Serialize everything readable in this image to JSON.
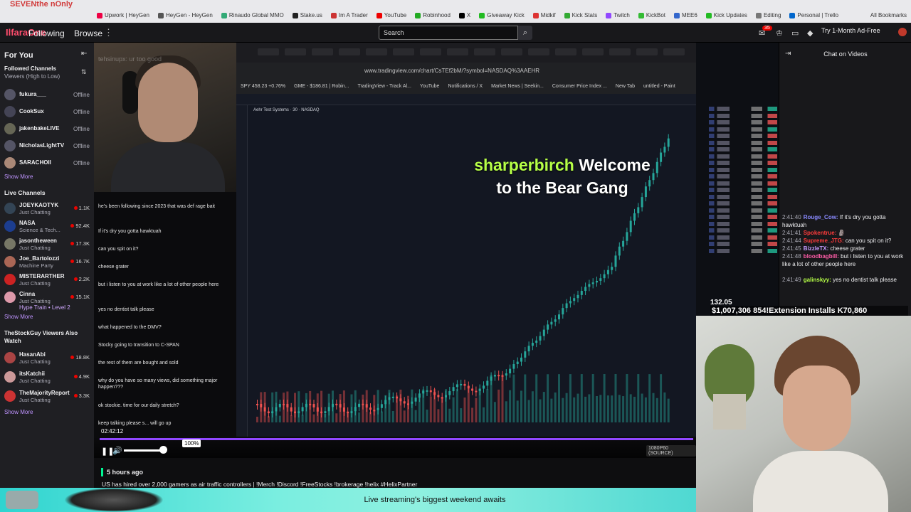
{
  "browser": {
    "tab_label": "SEVENthe nOnly",
    "bookmarks": [
      {
        "label": "Upwork | HeyGen",
        "color": "#e04"
      },
      {
        "label": "HeyGen - HeyGen",
        "color": "#555"
      },
      {
        "label": "Rinaudo Global MMO",
        "color": "#3a7"
      },
      {
        "label": "Stake.us",
        "color": "#222"
      },
      {
        "label": "Im A Trader",
        "color": "#c33"
      },
      {
        "label": "YouTube",
        "color": "#e00"
      },
      {
        "label": "Robinhood",
        "color": "#2a2"
      },
      {
        "label": "X",
        "color": "#000"
      },
      {
        "label": "Giveaway Kick",
        "color": "#2b2"
      },
      {
        "label": "Midkif",
        "color": "#d33"
      },
      {
        "label": "Kick Stats",
        "color": "#3a3"
      },
      {
        "label": "Twitch",
        "color": "#9147ff"
      },
      {
        "label": "KickBot",
        "color": "#3b3"
      },
      {
        "label": "MEE6",
        "color": "#36c"
      },
      {
        "label": "Kick Updates",
        "color": "#2b2"
      },
      {
        "label": "Editing",
        "color": "#777"
      },
      {
        "label": "Personal | Trello",
        "color": "#06c"
      }
    ],
    "all_bookmarks": "All Bookmarks"
  },
  "topbar": {
    "logo": "IlfaraOne",
    "following": "Following",
    "browse": "Browse",
    "more": "⋮",
    "search_placeholder": "Search",
    "search_icon": "⌕",
    "notif_count": "35",
    "try_adfree": "Try 1-Month Ad-Free"
  },
  "sidebar": {
    "for_you": "For You",
    "followed_header": "Followed Channels",
    "followed_sort": "Viewers (High to Low)",
    "followed": [
      {
        "name": "fukura___",
        "status": "Offline",
        "color": "#556"
      },
      {
        "name": "CookSux",
        "status": "Offline",
        "color": "#445"
      },
      {
        "name": "jakenbakeLIVE",
        "status": "Offline",
        "color": "#665"
      },
      {
        "name": "NicholasLightTV",
        "status": "Offline",
        "color": "#556"
      },
      {
        "name": "SARACHOII",
        "status": "Offline",
        "color": "#a87"
      }
    ],
    "show_more_1": "Show More",
    "live_header": "Live Channels",
    "live": [
      {
        "name": "JOEYKAOTYK",
        "game": "Just Chatting",
        "viewers": "1.1K",
        "color": "#345"
      },
      {
        "name": "NASA",
        "game": "Science & Tech...",
        "viewers": "92.4K",
        "color": "#1c3d8f"
      },
      {
        "name": "jasontheween",
        "game": "Just Chatting",
        "viewers": "17.3K",
        "color": "#776"
      },
      {
        "name": "Joe_Bartolozzi",
        "game": "Machine Party",
        "viewers": "16.7K",
        "color": "#a65"
      },
      {
        "name": "MISTERARTHER",
        "game": "Just Chatting",
        "viewers": "2.2K",
        "color": "#c22"
      },
      {
        "name": "Cinna",
        "game": "Just Chatting",
        "viewers": "15.1K",
        "color": "#d9a"
      }
    ],
    "hype_train": "Hype Train • Level 2",
    "show_more_2": "Show More",
    "also_watch_header": "TheStockGuy Viewers Also Watch",
    "also_watch": [
      {
        "name": "HasanAbi",
        "game": "Just Chatting",
        "viewers": "18.8K",
        "color": "#a44"
      },
      {
        "name": "itsKatchii",
        "game": "Just Chatting",
        "viewers": "4.9K",
        "color": "#c99"
      },
      {
        "name": "TheMajorityReport",
        "game": "Just Chatting",
        "viewers": "3.3K",
        "color": "#c33"
      }
    ],
    "show_more_3": "Show More"
  },
  "stream": {
    "overlay_name": "sharperbirch",
    "overlay_text_1": "Welcome",
    "overlay_text_2": "to the Bear Gang",
    "webcam_overlay": "tehsinupx: ur too good",
    "tv_url": "www.tradingview.com/chart/CsTEf2bM/?symbol=NASDAQ%3AAEHR",
    "tv_bookmarks": [
      "SPY 458.23 +0.76%",
      "GME - $186.81 | Robin...",
      "TradingView - Track Al...",
      "YouTube",
      "Notifications / X",
      "Market News | Seekin...",
      "Consumer Price Index ...",
      "New Tab",
      "untitled - Paint"
    ],
    "tv_symbol": "Aehr Test Systems · 30 · NASDAQ",
    "stream_chat": [
      {
        "user": "",
        "text": "he's been following since 2023 that was def rage bait"
      },
      {
        "user": "",
        "text": "If it's dry you gotta hawktuah"
      },
      {
        "user": "",
        "text": "can you spit on it?"
      },
      {
        "user": "",
        "text": "cheese grater"
      },
      {
        "user": "",
        "text": "but i listen to you at work like a lot of other people here"
      },
      {
        "user": "",
        "text": "yes no dentist talk please"
      },
      {
        "user": "",
        "text": "what happened to the DMV?"
      },
      {
        "user": "",
        "text": "Stocky going to transition to C-SPAN"
      },
      {
        "user": "",
        "text": "the rest of them are bought and sold"
      },
      {
        "user": "",
        "text": "why do you have so many views, did something major happen???"
      },
      {
        "user": "",
        "text": "ok stockie. time for our daily stretch?"
      },
      {
        "user": "",
        "text": "keep talking please s... will go up"
      }
    ],
    "time": "02:42:12",
    "volume_tip": "100%",
    "volume": 0.9,
    "progress": 1.0,
    "quality": "1080P60 (SOURCE)",
    "play_icon": "❚❚",
    "volume_icon": "🔊"
  },
  "below": {
    "ago": "5 hours ago",
    "title": "US has hired over 2,000 gamers as air traffic controllers | !Merch !Discord !FreeStocks !brokerage !helix #HelixPartner"
  },
  "chat": {
    "title": "Chat on Videos",
    "messages": [
      {
        "time": "2:41:40",
        "user": "Rouge_Cow:",
        "ucolor": "#8a8aff",
        "text": "If it's dry you gotta hawktuah"
      },
      {
        "time": "2:41:41",
        "user": "Spokentrue:",
        "ucolor": "#ff3b3b",
        "text": "🗿"
      },
      {
        "time": "2:41:44",
        "user": "Supreme_JTG:",
        "ucolor": "#ff3b3b",
        "text": "can you spit on it?"
      },
      {
        "time": "2:41:45",
        "user": "BizzleTX:",
        "ucolor": "#c59bff",
        "text": "cheese grater"
      },
      {
        "time": "2:41:48",
        "user": "bloodbagbill:",
        "ucolor": "#ff5ca8",
        "text": "but i listen to you at work like a lot of other people here"
      },
      {
        "time": "2:41:49",
        "user": "galinskyy:",
        "ucolor": "#b6ff47",
        "text": "yes no dentist talk please"
      }
    ]
  },
  "overlay_right": {
    "price": "132.05",
    "banner": "$1,007,306 854!Extension Installs K70,860"
  },
  "banner": {
    "text": "Live streaming's biggest weekend awaits"
  },
  "colors": {
    "accent": "#9147ff",
    "live": "#eb0400",
    "bull": "#26a69a",
    "bear": "#ef5350"
  }
}
